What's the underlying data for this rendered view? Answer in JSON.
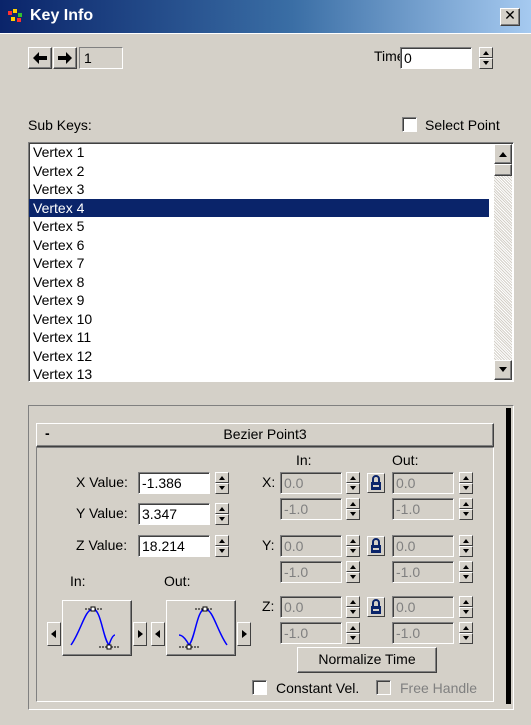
{
  "window": {
    "title": "Key Info",
    "close_glyph": "✕"
  },
  "nav": {
    "key_number": "1",
    "time_label": "Time:",
    "time_value": "0"
  },
  "subkeys": {
    "label": "Sub Keys:",
    "select_point_label": "Select Point",
    "items": [
      "Vertex 1",
      "Vertex 2",
      "Vertex 3",
      "Vertex 4",
      "Vertex 5",
      "Vertex 6",
      "Vertex 7",
      "Vertex 8",
      "Vertex 9",
      "Vertex 10",
      "Vertex 11",
      "Vertex 12",
      "Vertex 13"
    ],
    "selected_index": 3
  },
  "rollout": {
    "collapse_glyph": "-",
    "title": "Bezier Point3",
    "x_label": "X Value:",
    "x_value": "-1.386",
    "y_label": "Y Value:",
    "y_value": "3.347",
    "z_label": "Z Value:",
    "z_value": "18.214",
    "in_header": "In:",
    "out_header": "Out:",
    "axis_x": "X:",
    "axis_y": "Y:",
    "axis_z": "Z:",
    "x_in": "0.0",
    "x_in2": "-1.0",
    "x_out": "0.0",
    "x_out2": "-1.0",
    "y_in": "0.0",
    "y_in2": "-1.0",
    "y_out": "0.0",
    "y_out2": "-1.0",
    "z_in": "0.0",
    "z_in2": "-1.0",
    "z_out": "0.0",
    "z_out2": "-1.0",
    "tangent_in_label": "In:",
    "tangent_out_label": "Out:",
    "normalize_label": "Normalize Time",
    "constant_vel_label": "Constant Vel.",
    "free_handle_label": "Free Handle"
  },
  "colors": {
    "selection": "#0a246a",
    "curve": "#0000ff"
  }
}
